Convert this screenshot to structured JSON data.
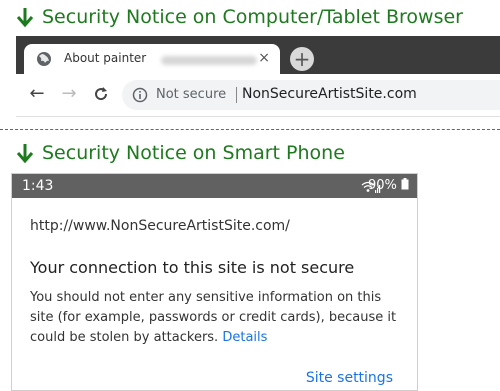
{
  "headings": {
    "desktop": "Security Notice on Computer/Tablet Browser",
    "phone": "Security Notice on Smart Phone"
  },
  "desktop": {
    "tab": {
      "icon": "globe-icon",
      "title": "About painter",
      "close_label": "×"
    },
    "new_tab_label": "+",
    "nav": {
      "back": "←",
      "forward": "→",
      "reload": "C"
    },
    "omnibox": {
      "icon": "info-icon",
      "security_label": "Not secure",
      "url": "NonSecureArtistSite.com"
    }
  },
  "phone": {
    "status": {
      "time": "1:43",
      "battery": "90%"
    },
    "dialog": {
      "url": "http://www.NonSecureArtistSite.com/",
      "heading": "Your connection to this site is not secure",
      "body": "You should not enter any sensitive information on this site (for example, passwords or credit cards), because it could be stolen by attackers.",
      "details_link": "Details",
      "site_settings": "Site settings"
    }
  },
  "colors": {
    "heading_green": "#1e7a1e",
    "tabbar_dark": "#3b3b3b",
    "link_blue": "#1a73e8",
    "phone_statusbar": "#616161"
  }
}
